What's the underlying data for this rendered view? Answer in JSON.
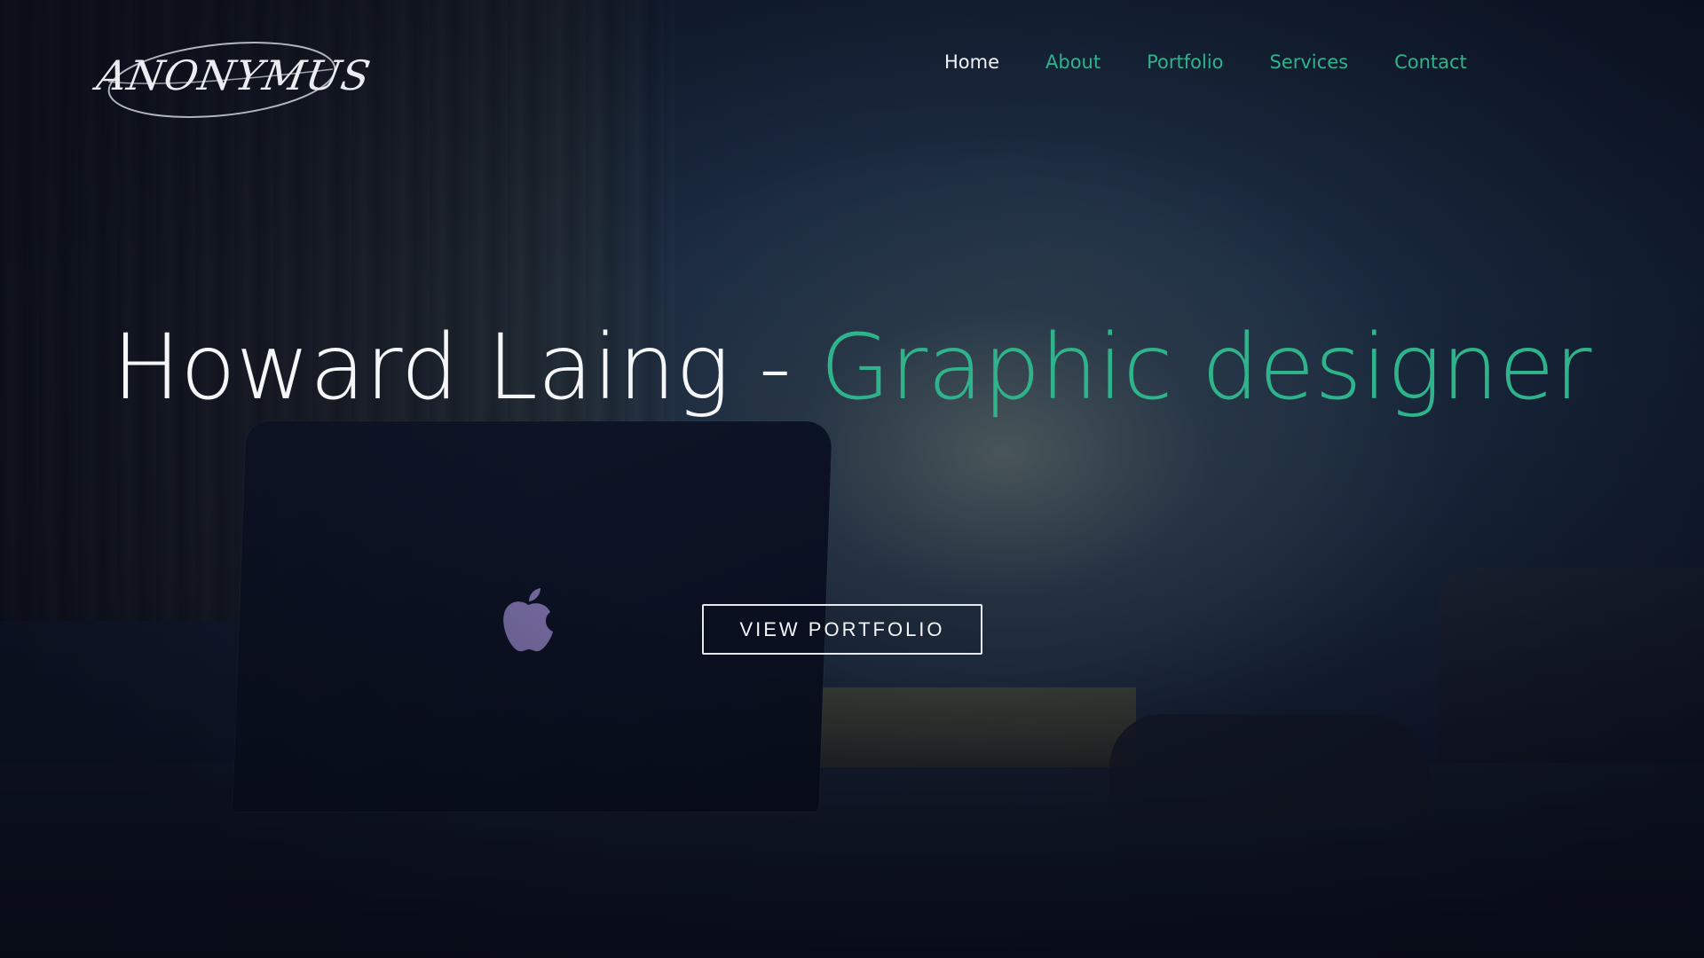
{
  "brand": {
    "logo_text": "ANONYMUS"
  },
  "nav": {
    "items": [
      {
        "label": "Home",
        "active": true
      },
      {
        "label": "About",
        "active": false
      },
      {
        "label": "Portfolio",
        "active": false
      },
      {
        "label": "Services",
        "active": false
      },
      {
        "label": "Contact",
        "active": false
      }
    ]
  },
  "hero": {
    "name": "Howard Laing",
    "separator": "-",
    "role": "Graphic designer",
    "cta_label": "VIEW PORTFOLIO"
  },
  "colors": {
    "accent": "#2fb38a",
    "text_light": "#f4f6f8",
    "background": "#0c1428"
  },
  "icons": {
    "laptop_logo": "apple-icon"
  }
}
